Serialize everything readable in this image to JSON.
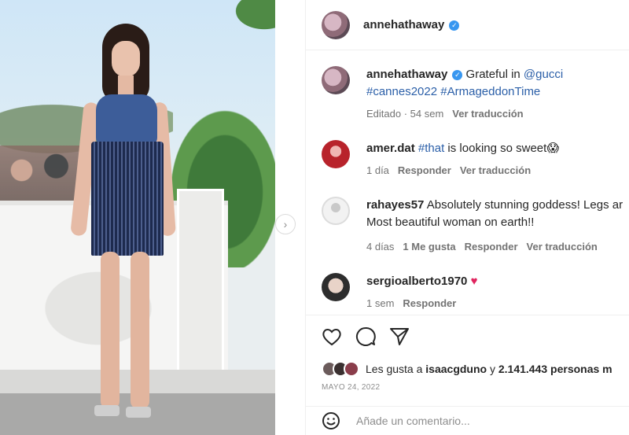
{
  "post": {
    "image_alt": "Anne Hathaway at Cannes photocall",
    "carousel_next": "›"
  },
  "header": {
    "username": "annehathaway",
    "verified": "✓"
  },
  "caption": {
    "username": "annehathaway",
    "text": "Grateful in",
    "mention": "@gucci",
    "tag1": "#cannes2022",
    "tag2": "#ArmageddonTime",
    "edited": "Editado",
    "time": "54 sem",
    "translate": "Ver traducción"
  },
  "comments": [
    {
      "username": "amer.dat",
      "tag": "#that",
      "text": "is looking so sweet",
      "emoji": "😱",
      "time": "1 día",
      "reply": "Responder",
      "translate": "Ver traducción"
    },
    {
      "username": "rahayes57",
      "text_line1": "Absolutely stunning goddess! Legs ar",
      "text_line2": "Most beautiful woman on earth!!",
      "time": "4 días",
      "likes": "1 Me gusta",
      "reply": "Responder",
      "translate": "Ver traducción"
    },
    {
      "username": "sergioalberto1970",
      "emoji": "♥",
      "time": "1 sem",
      "reply": "Responder"
    }
  ],
  "actions": {
    "likes_prefix": "Les gusta a",
    "likes_user": "isaacgduno",
    "likes_and": "y",
    "likes_count": "2.141.443 personas m",
    "date": "MAYO 24, 2022"
  },
  "comment_box": {
    "placeholder": "Añade un comentario..."
  },
  "icons": {
    "like": "heart-icon",
    "comment": "comment-icon",
    "share": "share-icon",
    "emoji": "emoji-icon"
  }
}
